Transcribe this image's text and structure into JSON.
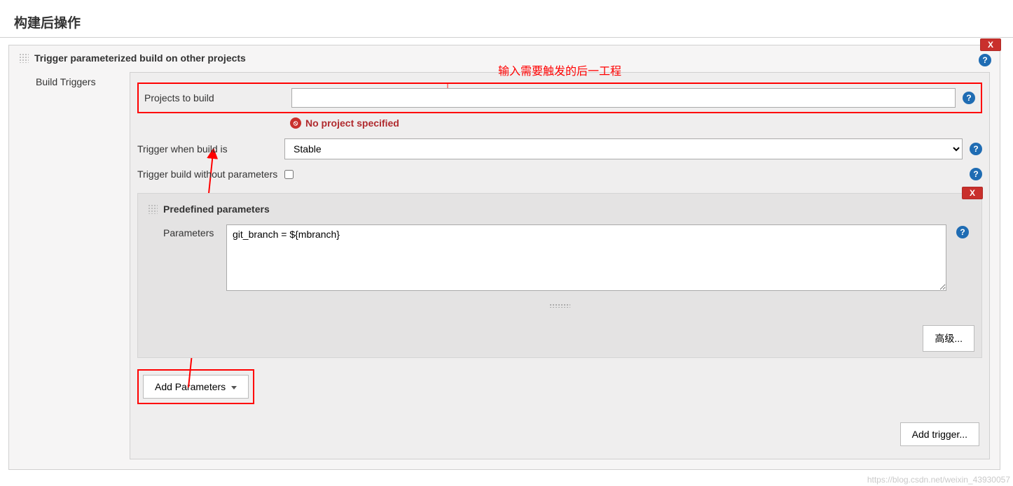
{
  "page_title": "构建后操作",
  "outer": {
    "close": "X",
    "header": "Trigger parameterized build on other projects",
    "side_label": "Build Triggers"
  },
  "annotation": "输入需要触发的后一工程",
  "form": {
    "projects_to_build_label": "Projects to build",
    "projects_to_build_value": "",
    "error_text": "No project specified",
    "trigger_when_label": "Trigger when build is",
    "trigger_when_value": "Stable",
    "trigger_without_params_label": "Trigger build without parameters"
  },
  "nested": {
    "close": "X",
    "header": "Predefined parameters",
    "parameters_label": "Parameters",
    "parameters_value": "git_branch = ${mbranch}",
    "advanced_button": "高级..."
  },
  "buttons": {
    "add_parameters": "Add Parameters",
    "add_trigger": "Add trigger..."
  },
  "watermark": "https://blog.csdn.net/weixin_43930057"
}
